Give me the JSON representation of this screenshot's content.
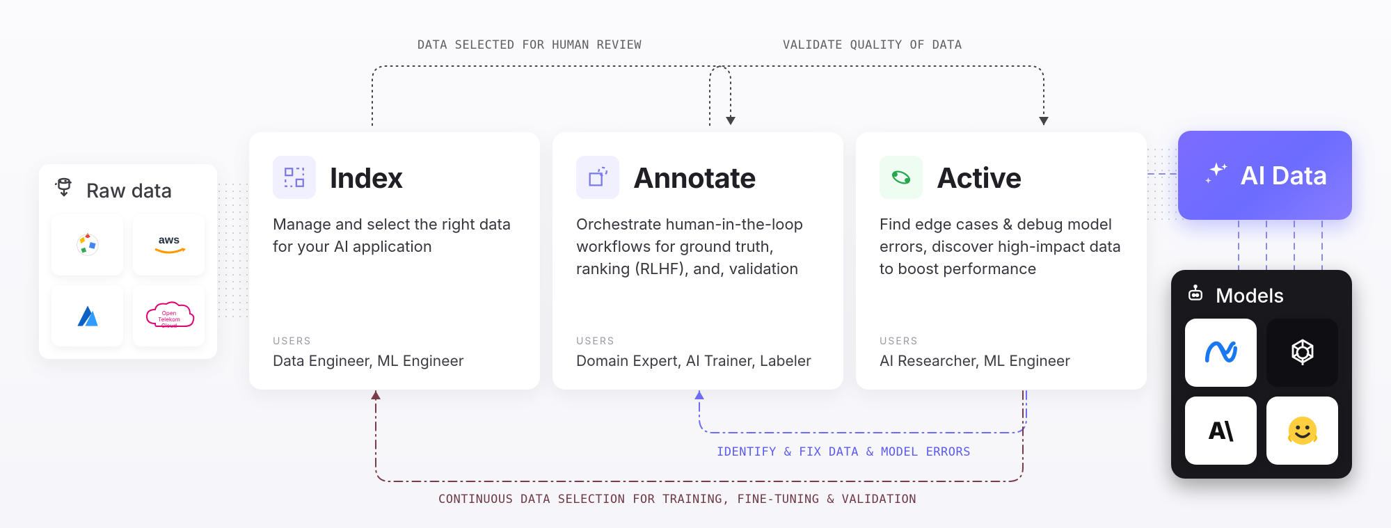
{
  "labels": {
    "top_left": "DATA SELECTED FOR HUMAN REVIEW",
    "top_right": "VALIDATE QUALITY OF DATA",
    "mid_violet": "IDENTIFY & FIX DATA & MODEL ERRORS",
    "bottom": "CONTINUOUS DATA SELECTION FOR TRAINING, FINE-TUNING & VALIDATION"
  },
  "raw": {
    "title": "Raw data",
    "providers": [
      "google-cloud",
      "aws",
      "azure",
      "open-telekom-cloud"
    ],
    "otc_label": "Open Telekom Cloud"
  },
  "stages": [
    {
      "key": "index",
      "title": "Index",
      "desc": "Manage and select the right data for your AI application",
      "users_label": "USERS",
      "users": "Data Engineer, ML Engineer"
    },
    {
      "key": "annotate",
      "title": "Annotate",
      "desc": "Orchestrate human-in-the-loop workflows for ground truth, ranking (RLHF), and, validation",
      "users_label": "USERS",
      "users": "Domain Expert, AI Trainer, Labeler"
    },
    {
      "key": "active",
      "title": "Active",
      "desc": "Find edge cases & debug model errors, discover high-impact data to boost performance",
      "users_label": "USERS",
      "users": "AI Researcher, ML Engineer"
    }
  ],
  "ai_data": {
    "title": "AI Data"
  },
  "models": {
    "title": "Models",
    "items": [
      "meta",
      "openai",
      "anthropic",
      "huggingface"
    ],
    "anthropic_label": "A\\"
  }
}
